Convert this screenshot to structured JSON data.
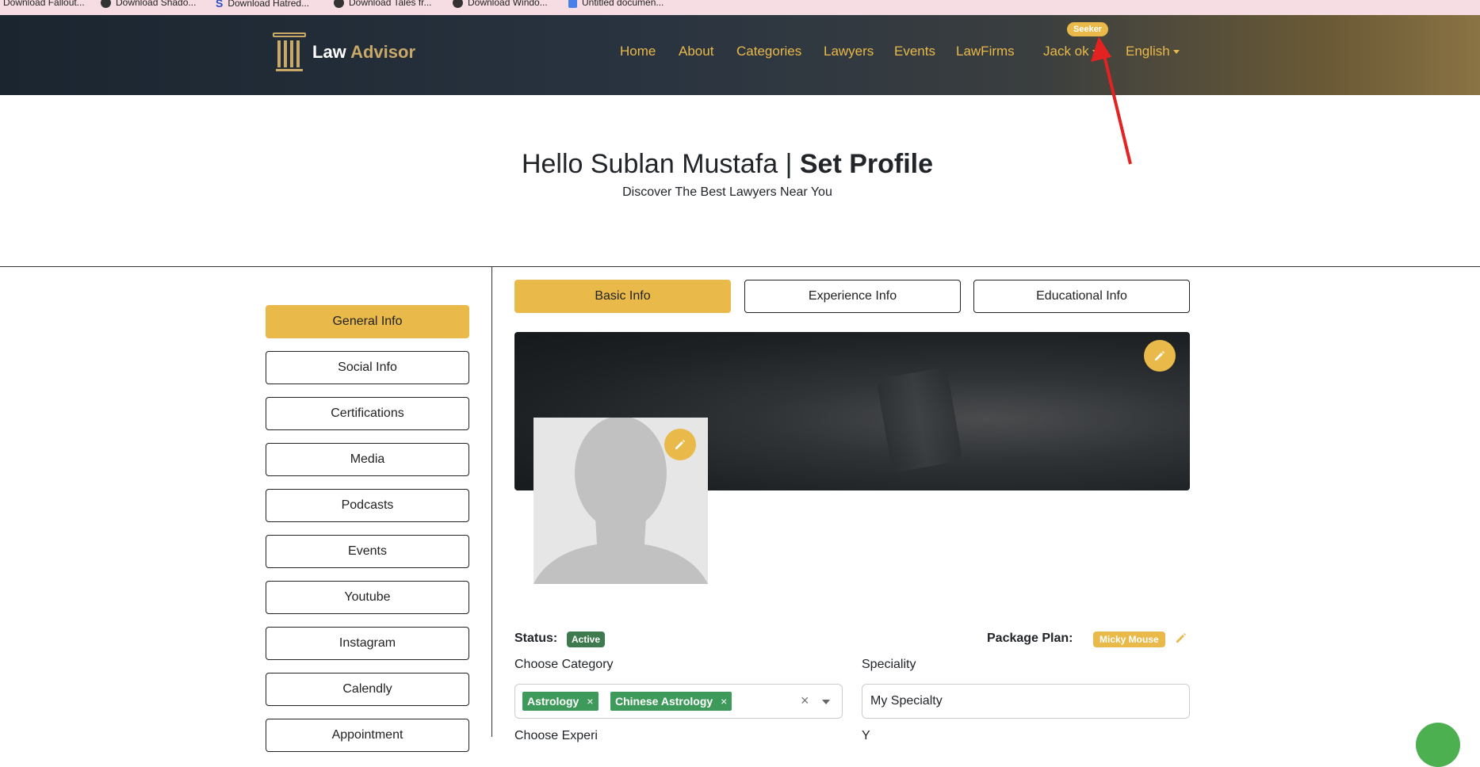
{
  "bookmarks": [
    {
      "label": "Download Fallout...",
      "icon": "globe-icon"
    },
    {
      "label": "Download Shado...",
      "icon": "globe-icon"
    },
    {
      "label": "Download Hatred...",
      "icon": "s-icon"
    },
    {
      "label": "Download Tales fr...",
      "icon": "globe-icon"
    },
    {
      "label": "Download Windo...",
      "icon": "globe-icon"
    },
    {
      "label": "Untitled documen...",
      "icon": "doc-icon"
    }
  ],
  "header": {
    "logo_text_1": "Law",
    "logo_text_2": " Advisor",
    "nav": [
      "Home",
      "About",
      "Categories",
      "Lawyers",
      "Events",
      "LawFirms"
    ],
    "user_name": "Jack ok",
    "user_badge": "Seeker",
    "language": "English"
  },
  "hero": {
    "title_prefix": "Hello Sublan Mustafa | ",
    "title_bold": "Set Profile",
    "subtitle": "Discover The Best Lawyers Near You"
  },
  "sidebar": {
    "items": [
      "General Info",
      "Social Info",
      "Certifications",
      "Media",
      "Podcasts",
      "Events",
      "Youtube",
      "Instagram",
      "Calendly",
      "Appointment"
    ],
    "active_index": 0
  },
  "tabs": {
    "items": [
      "Basic Info",
      "Experience Info",
      "Educational Info"
    ],
    "active_index": 0
  },
  "profile": {
    "status_label": "Status:",
    "status_value": "Active",
    "package_label": "Package Plan:",
    "package_value": "Micky Mouse",
    "category_label": "Choose Category",
    "categories": [
      "Astrology",
      "Chinese Astrology"
    ],
    "speciality_label": "Speciality",
    "speciality_value": "My Specialty",
    "next_label_left": "Choose Experi",
    "next_label_right": "Y"
  },
  "colors": {
    "accent": "#e9b949",
    "status_green": "#3d7a4e",
    "chip_green": "#3d9a5a",
    "annotation_arrow": "#e32222"
  }
}
